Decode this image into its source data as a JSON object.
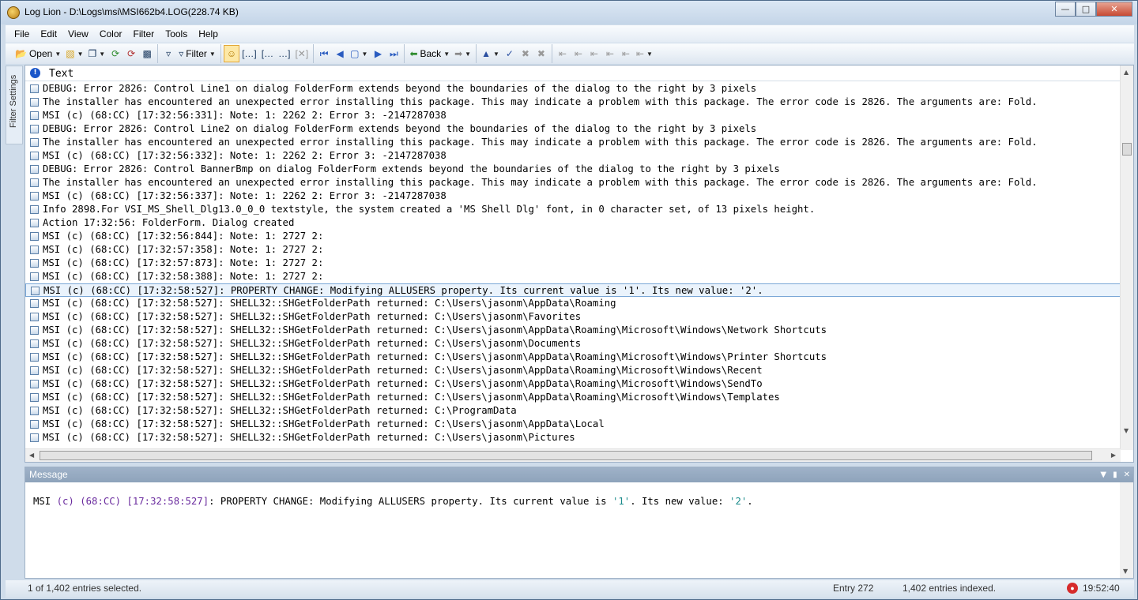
{
  "window": {
    "title": "Log Lion - D:\\Logs\\msi\\MSI662b4.LOG(228.74 KB)"
  },
  "menu": [
    "File",
    "Edit",
    "View",
    "Color",
    "Filter",
    "Tools",
    "Help"
  ],
  "toolbar": {
    "open_label": "Open",
    "filter_label": "Filter",
    "back_label": "Back"
  },
  "sidebar": {
    "label": "Filter Settings"
  },
  "grid": {
    "header": "Text",
    "selected_index": 15,
    "rows": [
      "DEBUG: Error 2826:  Control Line1 on dialog FolderForm extends beyond the boundaries of the dialog to the right by 3 pixels",
      "The installer has encountered an unexpected error installing this package. This may indicate a problem with this package. The error code is 2826. The arguments are: Fold.",
      "MSI (c) (68:CC) [17:32:56:331]: Note: 1: 2262 2: Error 3: -2147287038",
      "DEBUG: Error 2826:  Control Line2 on dialog FolderForm extends beyond the boundaries of the dialog to the right by 3 pixels",
      "The installer has encountered an unexpected error installing this package. This may indicate a problem with this package. The error code is 2826. The arguments are: Fold.",
      "MSI (c) (68:CC) [17:32:56:332]: Note: 1: 2262 2: Error 3: -2147287038",
      "DEBUG: Error 2826:  Control BannerBmp on dialog FolderForm extends beyond the boundaries of the dialog to the right by 3 pixels",
      "The installer has encountered an unexpected error installing this package. This may indicate a problem with this package. The error code is 2826. The arguments are: Fold.",
      "MSI (c) (68:CC) [17:32:56:337]: Note: 1: 2262 2: Error 3: -2147287038",
      "Info 2898.For VSI_MS_Shell_Dlg13.0_0_0 textstyle, the system created a 'MS Shell Dlg' font, in 0 character set, of 13 pixels height.",
      "Action 17:32:56: FolderForm. Dialog created",
      "MSI (c) (68:CC) [17:32:56:844]: Note: 1: 2727 2:",
      "MSI (c) (68:CC) [17:32:57:358]: Note: 1: 2727 2:",
      "MSI (c) (68:CC) [17:32:57:873]: Note: 1: 2727 2:",
      "MSI (c) (68:CC) [17:32:58:388]: Note: 1: 2727 2:",
      "MSI (c) (68:CC) [17:32:58:527]: PROPERTY CHANGE: Modifying ALLUSERS property. Its current value is '1'. Its new value: '2'.",
      "MSI (c) (68:CC) [17:32:58:527]: SHELL32::SHGetFolderPath returned: C:\\Users\\jasonm\\AppData\\Roaming",
      "MSI (c) (68:CC) [17:32:58:527]: SHELL32::SHGetFolderPath returned: C:\\Users\\jasonm\\Favorites",
      "MSI (c) (68:CC) [17:32:58:527]: SHELL32::SHGetFolderPath returned: C:\\Users\\jasonm\\AppData\\Roaming\\Microsoft\\Windows\\Network Shortcuts",
      "MSI (c) (68:CC) [17:32:58:527]: SHELL32::SHGetFolderPath returned: C:\\Users\\jasonm\\Documents",
      "MSI (c) (68:CC) [17:32:58:527]: SHELL32::SHGetFolderPath returned: C:\\Users\\jasonm\\AppData\\Roaming\\Microsoft\\Windows\\Printer Shortcuts",
      "MSI (c) (68:CC) [17:32:58:527]: SHELL32::SHGetFolderPath returned: C:\\Users\\jasonm\\AppData\\Roaming\\Microsoft\\Windows\\Recent",
      "MSI (c) (68:CC) [17:32:58:527]: SHELL32::SHGetFolderPath returned: C:\\Users\\jasonm\\AppData\\Roaming\\Microsoft\\Windows\\SendTo",
      "MSI (c) (68:CC) [17:32:58:527]: SHELL32::SHGetFolderPath returned: C:\\Users\\jasonm\\AppData\\Roaming\\Microsoft\\Windows\\Templates",
      "MSI (c) (68:CC) [17:32:58:527]: SHELL32::SHGetFolderPath returned: C:\\ProgramData",
      "MSI (c) (68:CC) [17:32:58:527]: SHELL32::SHGetFolderPath returned: C:\\Users\\jasonm\\AppData\\Local",
      "MSI (c) (68:CC) [17:32:58:527]: SHELL32::SHGetFolderPath returned: C:\\Users\\jasonm\\Pictures"
    ]
  },
  "message_panel": {
    "title": "Message",
    "parts": {
      "p1": "MSI ",
      "p2": "(c) (68:CC)",
      "p3": " ",
      "p4": "[17:32:58:527]",
      "p5": ": PROPERTY CHANGE: Modifying ALLUSERS property. Its current value is ",
      "p6": "'1'",
      "p7": ". Its new value: ",
      "p8": "'2'",
      "p9": "."
    }
  },
  "status": {
    "selection": "1 of 1,402 entries selected.",
    "entry": "Entry 272",
    "indexed": "1,402 entries indexed.",
    "time": "19:52:40"
  },
  "colors": {
    "selected_row": "#eaf3fc",
    "msg_purple": "#6a2b9e",
    "msg_teal": "#1a8b8b"
  }
}
